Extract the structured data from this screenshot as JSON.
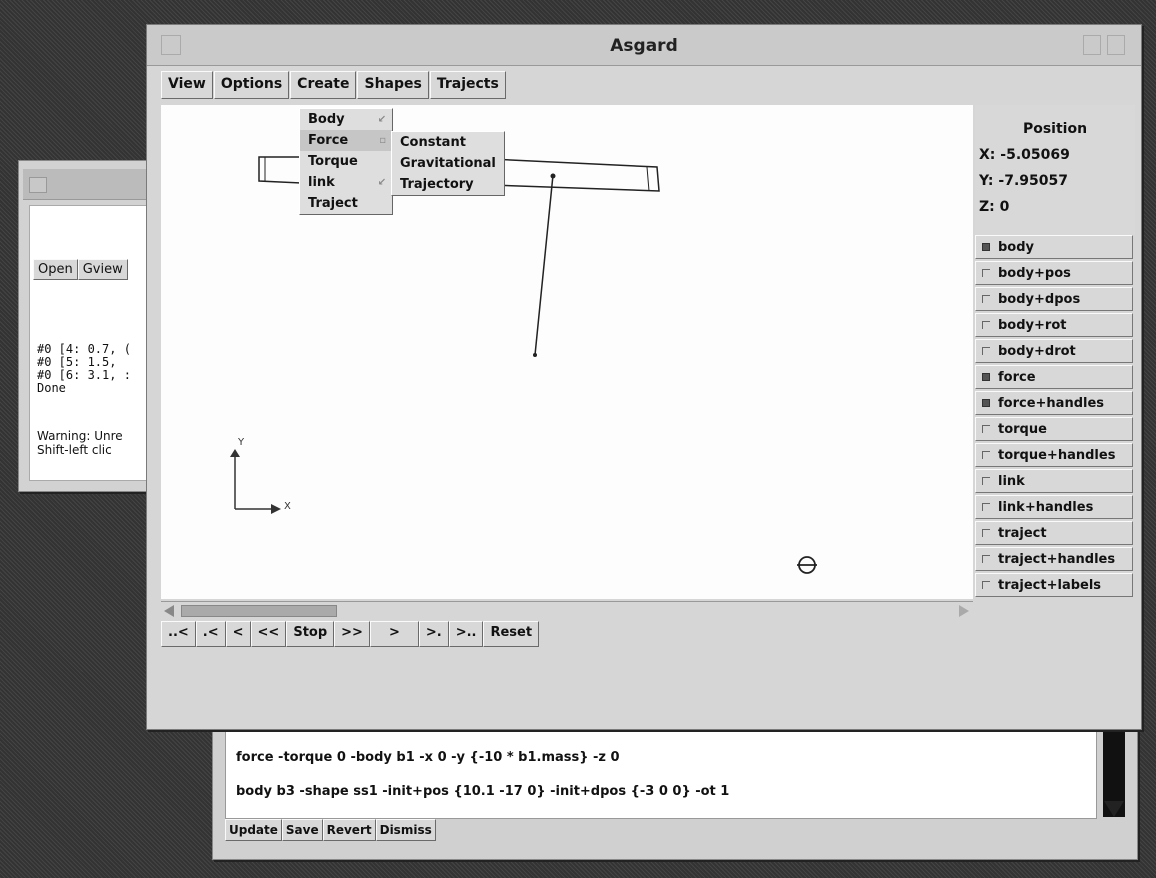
{
  "left_window": {
    "toolbar": [
      "Open",
      "Gview"
    ],
    "log_lines": [
      "#0 [4: 0.7, (",
      "#0 [5: 1.5, ",
      "#0 [6: 3.1, :",
      "Done"
    ],
    "warning_lines": [
      "Warning: Unre",
      "Shift-left clic"
    ]
  },
  "command_window": {
    "lines": [
      "force -torque 0 -body b1 -x 0 -y {-10 * b1.mass} -z 0",
      "body b3 -shape ss1 -init+pos {10.1 -17 0} -init+dpos {-3 0 0} -ot 1"
    ],
    "buttons": [
      "Update",
      "Save",
      "Revert",
      "Dismiss"
    ]
  },
  "main_window": {
    "title": "Asgard",
    "menubar": [
      "View",
      "Options",
      "Create",
      "Shapes",
      "Trajects"
    ],
    "create_menu": [
      {
        "label": "Body",
        "submenu": true
      },
      {
        "label": "Force",
        "submenu": true
      },
      {
        "label": "Torque",
        "submenu": false
      },
      {
        "label": "link",
        "submenu": true
      },
      {
        "label": "Traject",
        "submenu": false
      }
    ],
    "force_submenu": [
      "Constant",
      "Gravitational",
      "Trajectory"
    ],
    "axis_labels": {
      "y": "Y",
      "x": "X"
    },
    "position": {
      "title": "Position",
      "x": "X:  -5.05069",
      "y": "Y:  -7.95057",
      "z": "Z:  0"
    },
    "layers": [
      {
        "label": "body",
        "checked": true
      },
      {
        "label": "body+pos",
        "checked": false
      },
      {
        "label": "body+dpos",
        "checked": false
      },
      {
        "label": "body+rot",
        "checked": false
      },
      {
        "label": "body+drot",
        "checked": false
      },
      {
        "label": "force",
        "checked": true
      },
      {
        "label": "force+handles",
        "checked": true
      },
      {
        "label": "torque",
        "checked": false
      },
      {
        "label": "torque+handles",
        "checked": false
      },
      {
        "label": "link",
        "checked": false
      },
      {
        "label": "link+handles",
        "checked": false
      },
      {
        "label": "traject",
        "checked": false
      },
      {
        "label": "traject+handles",
        "checked": false
      },
      {
        "label": "traject+labels",
        "checked": false
      }
    ],
    "playback": [
      "..<",
      ".<",
      "<",
      "<<",
      "Stop",
      ">>",
      ">",
      ">.",
      ">..",
      "Reset"
    ]
  }
}
